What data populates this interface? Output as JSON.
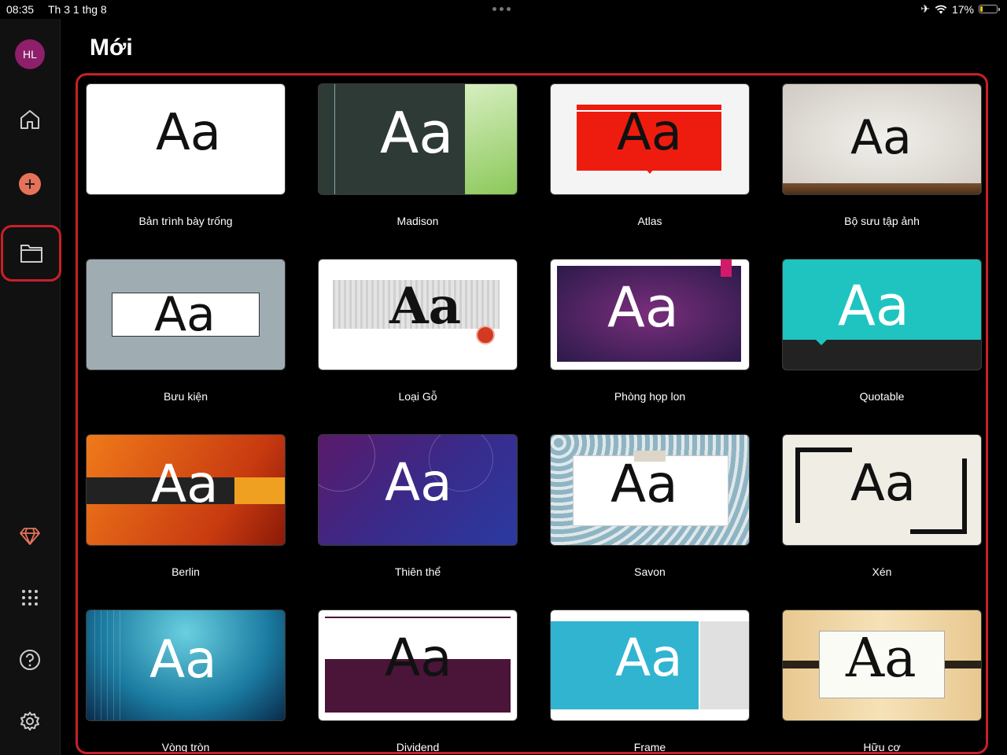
{
  "status": {
    "time": "08:35",
    "date": "Th 3 1 thg 8",
    "battery": "17%",
    "battery_level": 0.17
  },
  "sidebar": {
    "avatar_initials": "HL"
  },
  "page": {
    "title": "Mới"
  },
  "templates": [
    {
      "name": "Bản trình bày trống",
      "sample": "Aa"
    },
    {
      "name": "Madison",
      "sample": "Aa"
    },
    {
      "name": "Atlas",
      "sample": "Aa"
    },
    {
      "name": "Bộ sưu tập ảnh",
      "sample": "Aa"
    },
    {
      "name": "Bưu kiện",
      "sample": "Aa"
    },
    {
      "name": "Loại Gỗ",
      "sample": "Aa"
    },
    {
      "name": "Phòng họp lon",
      "sample": "Aa"
    },
    {
      "name": "Quotable",
      "sample": "Aa"
    },
    {
      "name": "Berlin",
      "sample": "Aa"
    },
    {
      "name": "Thiên thể",
      "sample": "Aa"
    },
    {
      "name": "Savon",
      "sample": "Aa"
    },
    {
      "name": "Xén",
      "sample": "Aa"
    },
    {
      "name": "Vòng tròn",
      "sample": "Aa"
    },
    {
      "name": "Dividend",
      "sample": "Aa"
    },
    {
      "name": "Frame",
      "sample": "Aa"
    },
    {
      "name": "Hữu cơ",
      "sample": "Aa"
    }
  ],
  "colors": {
    "accent": "#c8202a",
    "add_button": "#e5735a",
    "avatar": "#8e1f6a"
  }
}
